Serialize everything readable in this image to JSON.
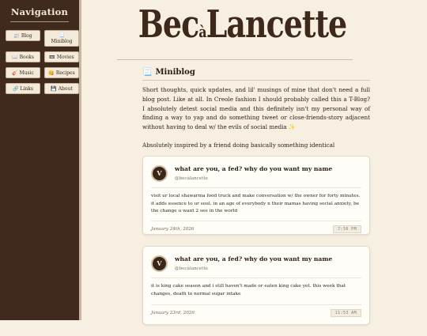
{
  "nav": {
    "title": "Navigation",
    "items": [
      {
        "icon": "📰",
        "label": "Blog"
      },
      {
        "icon": "📃",
        "label": "Miniblog"
      },
      {
        "icon": "📖",
        "label": "Books"
      },
      {
        "icon": "📼",
        "label": "Movies"
      },
      {
        "icon": "🎸",
        "label": "Music"
      },
      {
        "icon": "😋",
        "label": "Recipes"
      },
      {
        "icon": "🔗",
        "label": "Links"
      },
      {
        "icon": "💾",
        "label": "About"
      }
    ]
  },
  "logo": {
    "part1": "Bec",
    "part2": "à",
    "part3": "Lancette"
  },
  "page": {
    "icon": "📃",
    "title": "Miniblog",
    "intro": "Short thoughts, quick updates, and lil' musings of mine that don't need a full blog post. Like at all. In Creole fashion I should probably called this a T-Blog? I absolutely detest social media and this definitely isn't my personal way of finding a way to yap and do something tweet or close-friends-story adjacent without having to deal w/ the evils of social media ✨",
    "intro2": "Absolutely inspired by a friend doing basically something identical"
  },
  "posts": [
    {
      "avatar": "V",
      "title": "what are you, a fed? why do you want my name",
      "handle": "@becàlancette",
      "body": "visit ur local shawarma food truck and make conversation w/ the owner for forty minutes. it adds essence to ur soul. in an age of everybody n their mamas having social anxiety, be the change u want 2 see in the world",
      "date": "January 24th, 2026",
      "time": "7:56 PM"
    },
    {
      "avatar": "V",
      "title": "what are you, a fed? why do you want my name",
      "handle": "@becàlancette",
      "body": "it is king cake season and i still haven't made or eaten king cake yet. this week that changes, death to normal sugar intake",
      "date": "January 23rd, 2026",
      "time": "11:53 AM"
    }
  ]
}
